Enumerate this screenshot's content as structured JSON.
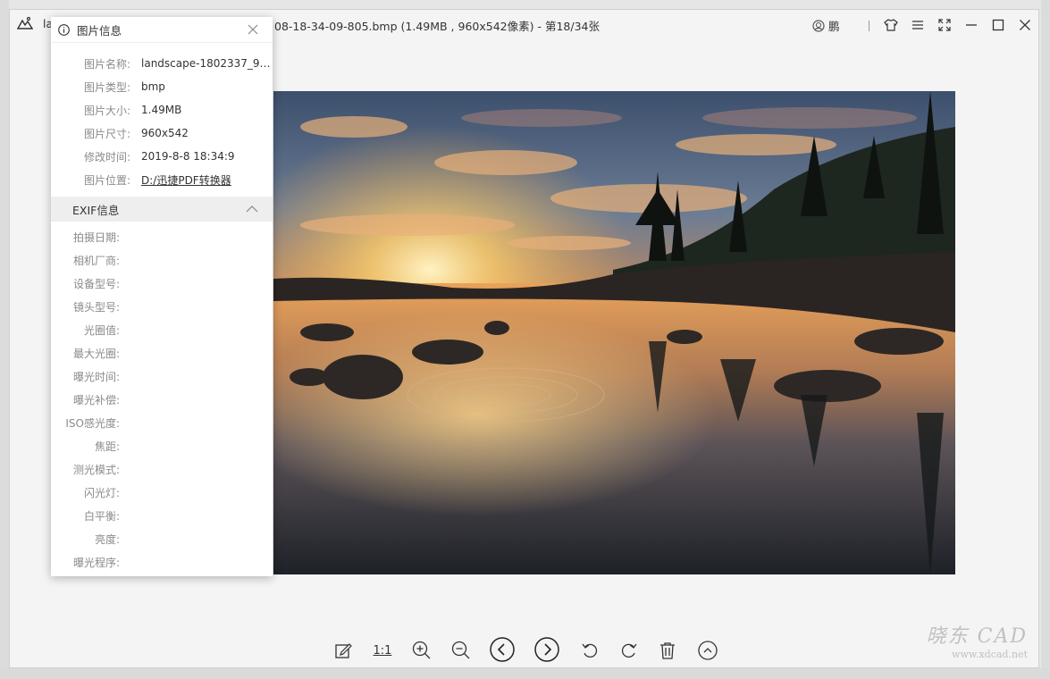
{
  "window": {
    "title_prefix": "la",
    "title": "08-18-34-09-805.bmp (1.49MB , 960x542像素) - 第18/34张",
    "user_name": "鹏"
  },
  "info_panel": {
    "header": "图片信息",
    "rows": [
      {
        "label": "图片名称:",
        "value": "landscape-1802337_96..."
      },
      {
        "label": "图片类型:",
        "value": "bmp"
      },
      {
        "label": "图片大小:",
        "value": "1.49MB"
      },
      {
        "label": "图片尺寸:",
        "value": "960x542"
      },
      {
        "label": "修改时间:",
        "value": "2019-8-8 18:34:9"
      },
      {
        "label": "图片位置:",
        "value": "D:/迅捷PDF转换器"
      }
    ],
    "exif_header": "EXIF信息",
    "exif_rows": [
      {
        "label": "拍摄日期:",
        "value": ""
      },
      {
        "label": "相机厂商:",
        "value": ""
      },
      {
        "label": "设备型号:",
        "value": ""
      },
      {
        "label": "镜头型号:",
        "value": ""
      },
      {
        "label": "光圈值:",
        "value": ""
      },
      {
        "label": "最大光圈:",
        "value": ""
      },
      {
        "label": "曝光时间:",
        "value": ""
      },
      {
        "label": "曝光补偿:",
        "value": ""
      },
      {
        "label": "ISO感光度:",
        "value": ""
      },
      {
        "label": "焦距:",
        "value": ""
      },
      {
        "label": "测光模式:",
        "value": ""
      },
      {
        "label": "闪光灯:",
        "value": ""
      },
      {
        "label": "白平衡:",
        "value": ""
      },
      {
        "label": "亮度:",
        "value": ""
      },
      {
        "label": "曝光程序:",
        "value": ""
      }
    ]
  },
  "toolbar": {
    "one_to_one": "1:1",
    "icons": [
      "edit-icon",
      "zoom-in-icon",
      "zoom-out-icon",
      "previous-icon",
      "next-icon",
      "rotate-left-icon",
      "rotate-right-icon",
      "delete-icon",
      "collapse-up-icon"
    ]
  },
  "watermark": {
    "line1": "晓东 CAD",
    "line2": "www.xdcad.net"
  },
  "colors": {
    "window_bg": "#f4f4f4",
    "panel_bg": "#ffffff",
    "exif_header_bg": "#eeeeee",
    "label_gray": "#8a8a8a"
  }
}
